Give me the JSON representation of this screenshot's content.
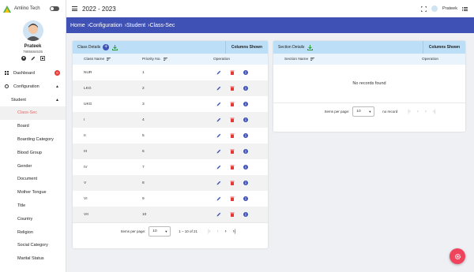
{
  "app": {
    "brand": "Amlino Tech",
    "year": "2022 - 2023",
    "username": "Prateek"
  },
  "profile": {
    "name": "Prateek",
    "phone": "7985684535"
  },
  "nav": {
    "dashboard": "Dashboard",
    "dashboard_badge": "0",
    "configuration": "Configuration",
    "student": "Student",
    "items": [
      "Class-Sec",
      "Board",
      "Boarding Category",
      "Blood Group",
      "Gender",
      "Document",
      "Mother Tongue",
      "Title",
      "Country",
      "Religion",
      "Social Category",
      "Marital Status"
    ]
  },
  "breadcrumb": [
    "Home",
    "›Configuration",
    "›Student",
    "›Class-Sec"
  ],
  "class_card": {
    "title": "Class Details",
    "add_label": "+",
    "columns_shown": "Columns Shown",
    "headers": [
      "Class Name",
      "Priority No.",
      "Operation"
    ],
    "rows": [
      {
        "name": "NUR",
        "priority": "1"
      },
      {
        "name": "LKG",
        "priority": "2"
      },
      {
        "name": "UKG",
        "priority": "3"
      },
      {
        "name": "I",
        "priority": "4"
      },
      {
        "name": "II",
        "priority": "5"
      },
      {
        "name": "III",
        "priority": "6"
      },
      {
        "name": "IV",
        "priority": "7"
      },
      {
        "name": "V",
        "priority": "8"
      },
      {
        "name": "VI",
        "priority": "9"
      },
      {
        "name": "VII",
        "priority": "10"
      }
    ],
    "pager": {
      "items_label": "Items per page:",
      "size": "10",
      "range": "1 – 10 of 21"
    }
  },
  "section_card": {
    "title": "Section Details",
    "columns_shown": "Columns Shown",
    "headers": [
      "Section Name",
      "Operation"
    ],
    "empty": "No records found",
    "pager": {
      "items_label": "Items per page:",
      "size": "10",
      "range": "no record"
    }
  },
  "colors": {
    "primary": "#3f51b5",
    "header": "#bcdff7",
    "fab": "#f0445d",
    "delete": "#e53935",
    "info": "#3f51b5",
    "active": "#e06a6a"
  },
  "icons": [
    "theme-toggle-icon",
    "menu-icon",
    "fullscreen-icon",
    "list-icon",
    "user-icon",
    "edit-icon",
    "settings-icon",
    "download-icon",
    "sort-icon",
    "delete-icon",
    "info-icon",
    "gear-icon"
  ]
}
